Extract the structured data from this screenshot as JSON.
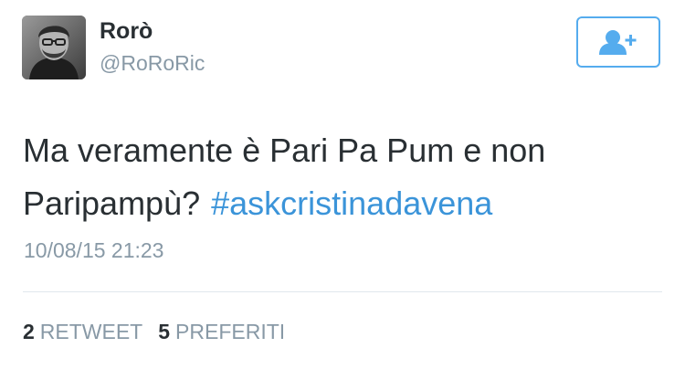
{
  "tweet": {
    "author": {
      "name": "Rorò",
      "handle": "@RoRoRic"
    },
    "text_line1": "Ma veramente è Pari Pa Pum e non",
    "text_line2": "Paripampù?",
    "hashtag": "#askcristinadavena",
    "timestamp": "10/08/15 21:23",
    "retweets": {
      "count": "2",
      "label": "RETWEET"
    },
    "favorites": {
      "count": "5",
      "label": "PREFERITI"
    }
  },
  "follow_button": {
    "icon": "add-user-icon",
    "color": "#55acee"
  },
  "colors": {
    "text": "#292f33",
    "secondary": "#8899a6",
    "link": "#3b94d9",
    "divider": "#e1e8ed"
  }
}
